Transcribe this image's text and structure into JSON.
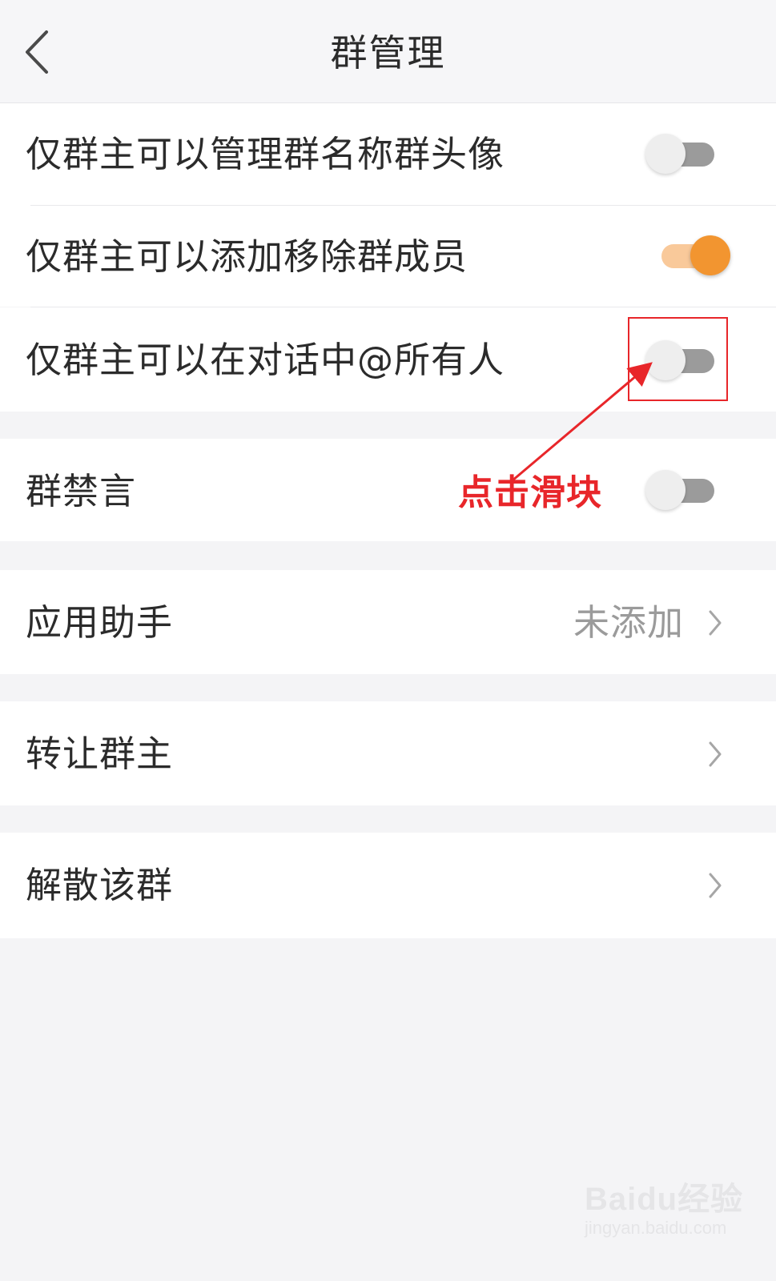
{
  "header": {
    "title": "群管理",
    "back_icon": "chevron-left-icon"
  },
  "settings": {
    "owner_manage_name_avatar": {
      "label": "仅群主可以管理群名称群头像",
      "enabled": false
    },
    "owner_add_remove_members": {
      "label": "仅群主可以添加移除群成员",
      "enabled": true
    },
    "owner_at_all": {
      "label": "仅群主可以在对话中@所有人",
      "enabled": false
    },
    "group_mute": {
      "label": "群禁言",
      "enabled": false
    }
  },
  "app_assistant": {
    "label": "应用助手",
    "value": "未添加"
  },
  "transfer_owner": {
    "label": "转让群主"
  },
  "dissolve_group": {
    "label": "解散该群"
  },
  "annotation": {
    "text": "点击滑块",
    "color": "#e8262a"
  },
  "colors": {
    "switch_on": "#f29530",
    "switch_off_track": "#9b9b9b",
    "annotation": "#e8262a"
  },
  "watermark": {
    "logo": "Baidu经验",
    "url": "jingyan.baidu.com"
  }
}
